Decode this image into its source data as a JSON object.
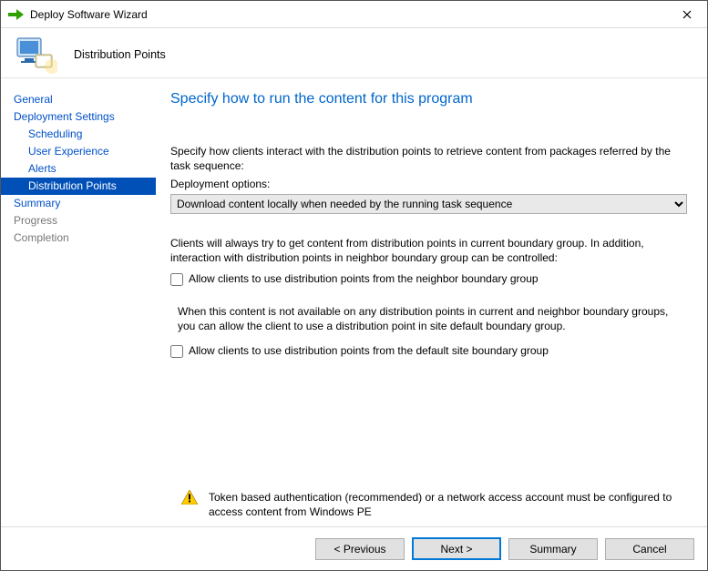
{
  "window": {
    "title": "Deploy Software Wizard"
  },
  "header": {
    "page_title": "Distribution Points"
  },
  "sidebar": {
    "items": [
      {
        "label": "General",
        "cls": "item link"
      },
      {
        "label": "Deployment Settings",
        "cls": "item link"
      },
      {
        "label": "Scheduling",
        "cls": "item sub link"
      },
      {
        "label": "User Experience",
        "cls": "item sub link"
      },
      {
        "label": "Alerts",
        "cls": "item sub link"
      },
      {
        "label": "Distribution Points",
        "cls": "item sub selected"
      },
      {
        "label": "Summary",
        "cls": "item link"
      },
      {
        "label": "Progress",
        "cls": "item disabled"
      },
      {
        "label": "Completion",
        "cls": "item disabled"
      }
    ]
  },
  "content": {
    "heading": "Specify how to run the content for this program",
    "intro": "Specify how clients interact with the distribution points to retrieve content from packages referred by the task sequence:",
    "deploy_options_label": "Deployment options:",
    "deploy_options_value": "Download content locally when needed by the running task sequence",
    "boundary_para": "Clients will always try to get content from distribution points in current boundary group. In addition, interaction with distribution points in neighbor boundary group can be controlled:",
    "chk_neighbor": "Allow clients to use distribution points from the neighbor boundary group",
    "fallback_para": "When this content is not available on any distribution points in current and neighbor boundary groups, you can allow the client to use a distribution point in site default boundary group.",
    "chk_default": "Allow clients to use distribution points from the default site boundary group",
    "warning": "Token based authentication (recommended) or a network access account must be configured to access content from Windows PE"
  },
  "footer": {
    "previous": "< Previous",
    "next": "Next >",
    "summary": "Summary",
    "cancel": "Cancel"
  }
}
